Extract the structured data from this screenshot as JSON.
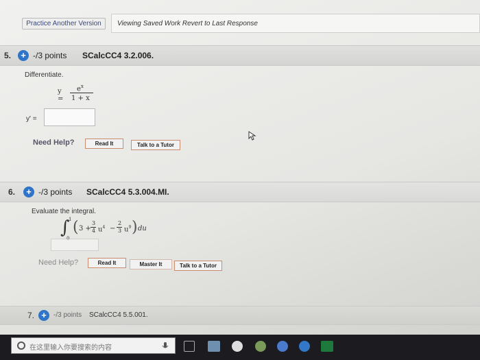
{
  "toolbar": {
    "practice_label": "Practice Another Version",
    "viewing_text": "Viewing Saved Work Revert to Last Response"
  },
  "q5": {
    "number": "5.",
    "points": "-/3 points",
    "code": "SCalcCC4 3.2.006.",
    "prompt": "Differentiate.",
    "eq_lhs": "y =",
    "eq_num": "e",
    "eq_num_exp": "x",
    "eq_den": "1 + x",
    "answer_label": "y' =",
    "answer_value": "",
    "need_help": "Need Help?",
    "read_it": "Read It",
    "talk_tutor": "Talk to a Tutor"
  },
  "q6": {
    "number": "6.",
    "points": "-/3 points",
    "code": "SCalcCC4 5.3.004.MI.",
    "prompt": "Evaluate the integral.",
    "upper": "1",
    "lower": "0",
    "integrand_a": "3 +",
    "f1_num": "3",
    "f1_den": "4",
    "term1_var": "u",
    "term1_exp": "4",
    "minus": "−",
    "f2_num": "2",
    "f2_den": "3",
    "term2_var": "u",
    "term2_exp": "9",
    "du": "du",
    "need_help": "Need Help?",
    "read_it": "Read It",
    "master_it": "Master It",
    "talk_tutor": "Talk to a Tutor"
  },
  "q7": {
    "number": "7.",
    "points": "-/3 points",
    "code": "SCalcCC4 5.5.001."
  },
  "taskbar": {
    "search_placeholder": "在这里输入你要搜索的内容",
    "colors": {
      "bar": "#1c1c20",
      "edge": "#3277c8",
      "excel": "#1e7a3c"
    }
  }
}
